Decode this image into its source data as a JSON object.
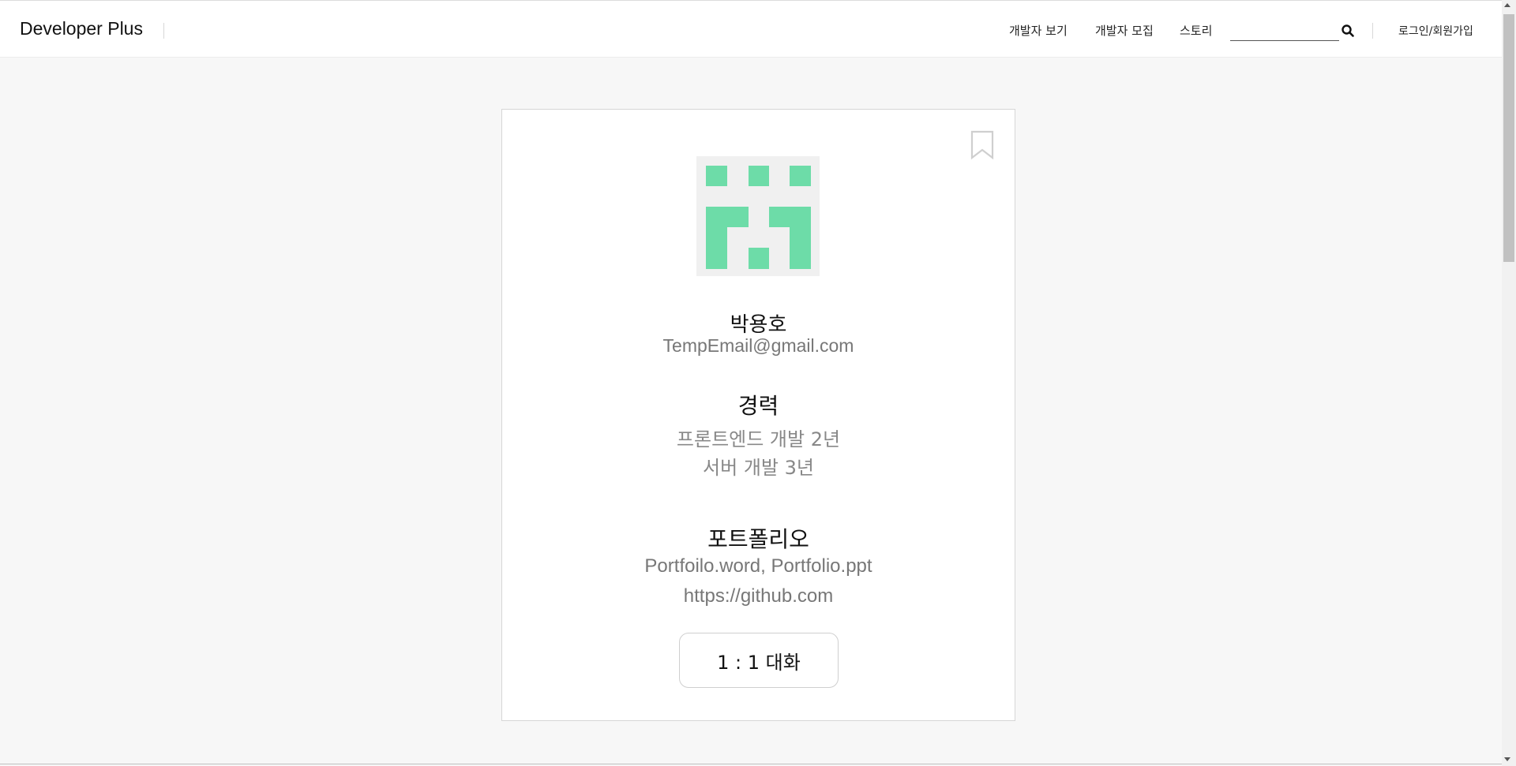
{
  "header": {
    "brand": "Developer Plus",
    "nav": {
      "developers": "개발자 보기",
      "recruit": "개발자 모집",
      "story": "스토리"
    },
    "search": {
      "placeholder": "",
      "value": ""
    },
    "auth": "로그인/회원가입"
  },
  "profile": {
    "name": "박용호",
    "email": "TempEmail@gmail.com",
    "experience": {
      "title": "경력",
      "items": [
        "프론트엔드 개발 2년",
        "서버 개발 3년"
      ]
    },
    "portfolio": {
      "title": "포트폴리오",
      "files": "Portfoilo.word, Portfolio.ppt",
      "link": "https://github.com"
    },
    "chat_button": "1 : 1 대화"
  },
  "colors": {
    "avatar_green": "#6ddca8",
    "avatar_bg": "#f0f0f0",
    "page_bg": "#f7f7f7"
  },
  "icons": [
    "search-icon",
    "bookmark-icon",
    "identicon-avatar"
  ]
}
